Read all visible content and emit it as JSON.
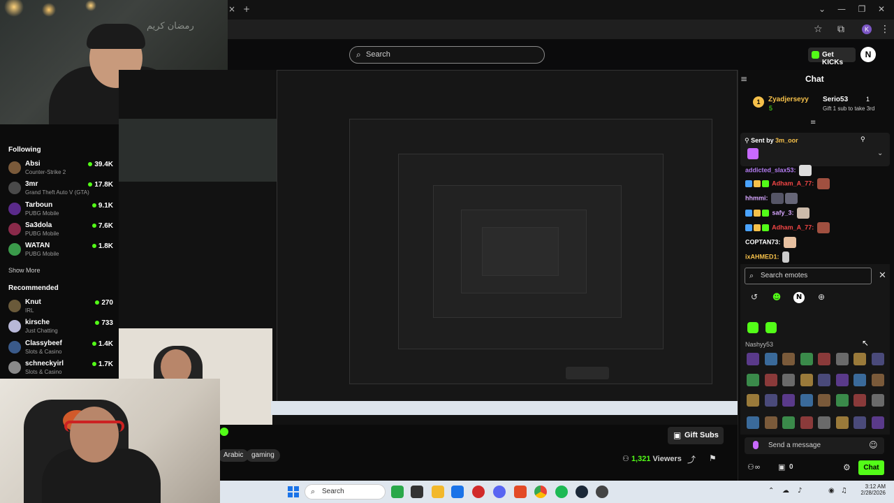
{
  "browser": {
    "new_tab_symbol": "+",
    "close_symbol": "×",
    "window_controls": [
      "⌄",
      "—",
      "❐",
      "✕"
    ],
    "profile_initial": "K"
  },
  "header": {
    "search_placeholder": "Search",
    "get_kicks_label": "Get KICKs",
    "logo_letter": "N"
  },
  "sidebar": {
    "following_title": "Following",
    "following": [
      {
        "name": "Absi",
        "game": "Counter-Strike 2",
        "viewers": "39.4K",
        "color": "#7a5a3a"
      },
      {
        "name": "3mr",
        "game": "Grand Theft Auto V (GTA)",
        "viewers": "17.8K",
        "color": "#4a4a4a"
      },
      {
        "name": "Tarboun",
        "game": "PUBG Mobile",
        "viewers": "9.1K",
        "color": "#5a2a8a"
      },
      {
        "name": "Sa3dola",
        "game": "PUBG Mobile",
        "viewers": "7.6K",
        "color": "#8a2a4a"
      },
      {
        "name": "WATAN",
        "game": "PUBG Mobile",
        "viewers": "1.8K",
        "color": "#3a9a4a"
      }
    ],
    "show_more_label": "Show More",
    "recommended_title": "Recommended",
    "recommended": [
      {
        "name": "Knut",
        "game": "IRL",
        "viewers": "270",
        "color": "#6a5a3a"
      },
      {
        "name": "kirsche",
        "game": "Just Chatting",
        "viewers": "733",
        "color": "#b8b8d8"
      },
      {
        "name": "Classybeef",
        "game": "Slots & Casino",
        "viewers": "1.4K",
        "color": "#3a5a8a"
      },
      {
        "name": "schneckyirl",
        "game": "Slots & Casino",
        "viewers": "1.7K",
        "color": "#8a8a8a"
      }
    ]
  },
  "webcam": {
    "overlay_text": "رمضان كريم"
  },
  "stream": {
    "tags": [
      "Arabic",
      "gaming"
    ],
    "gift_subs_label": "Gift Subs",
    "viewers_count": "1,321",
    "viewers_label": "Viewers"
  },
  "chat": {
    "title": "Chat",
    "gift_banner": {
      "rank": "1",
      "gifter": "Zyadjerseyy",
      "gifter_count": "5",
      "recipient": "Serio53",
      "recipient_count": "1",
      "subtitle": "Gift 1 sub to take 3rd"
    },
    "pinned": {
      "sent_by_label": "Sent by",
      "sender": "3m_oor"
    },
    "messages": [
      {
        "user": "addicted_slax53:",
        "color": "#b27cf0"
      },
      {
        "user": "Adham_A_77:",
        "color": "#f04545"
      },
      {
        "user": "hhmmi:",
        "color": "#d7a6ff"
      },
      {
        "user": "safy_3:",
        "color": "#d7a6ff"
      },
      {
        "user": "Adham_A_77:",
        "color": "#f04545"
      },
      {
        "user": "COPTAN73:",
        "color": "#ffffff"
      },
      {
        "user": "ixAHMED1:",
        "color": "#f5c04a"
      }
    ],
    "emote_search_placeholder": "Search emotes",
    "picker_tabs": [
      "↺",
      "☻",
      "N",
      "⊕"
    ],
    "channel_section": "Nashyy53",
    "send_placeholder": "Send a message",
    "chat_button": "Chat",
    "footer_count": "0"
  },
  "taskbar": {
    "search_placeholder": "Search",
    "time": "3:12 AM",
    "date": "2/28/2026"
  }
}
